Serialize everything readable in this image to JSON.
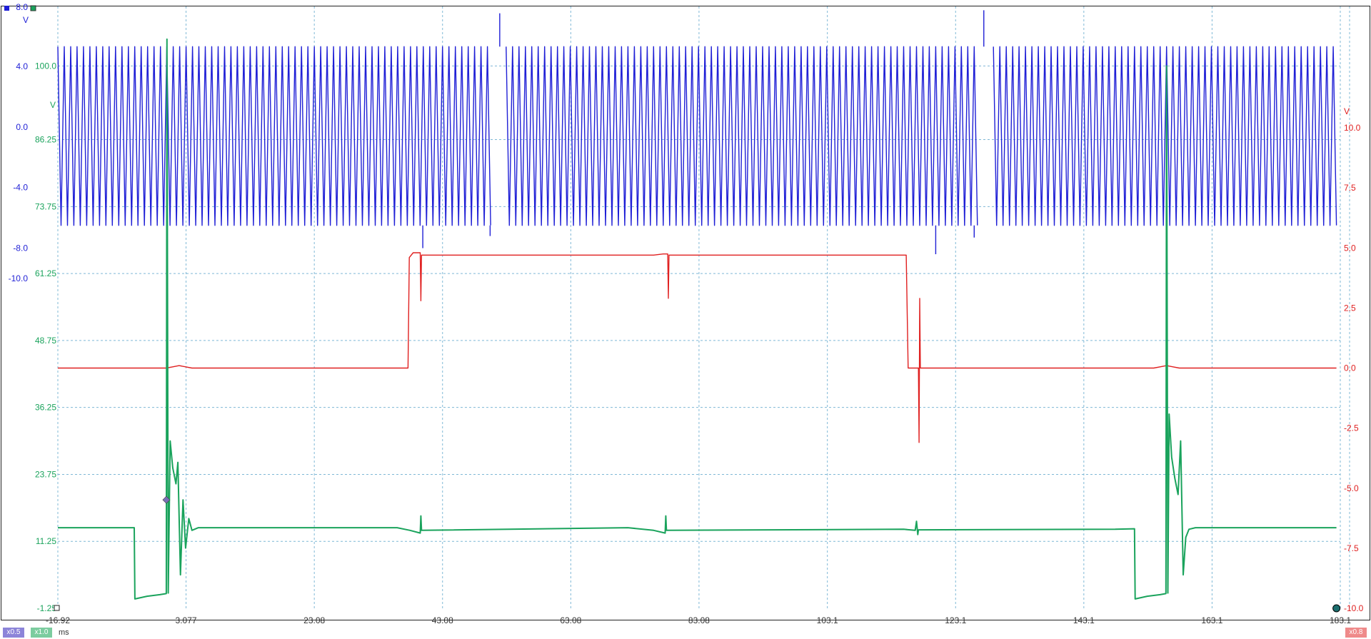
{
  "chart_data": {
    "type": "line",
    "title": "",
    "xlabel": "",
    "x_unit": "ms",
    "xlim": [
      -16.92,
      183.1
    ],
    "x_ticks": [
      -16.92,
      3.077,
      23.08,
      43.08,
      63.08,
      83.08,
      103.1,
      123.1,
      143.1,
      163.1,
      183.1
    ],
    "x_tick_labels": [
      "-16.92",
      "3.077",
      "23.08",
      "43.08",
      "63.08",
      "83.08",
      "103.1",
      "123.1",
      "143.1",
      "163.1",
      "183.1"
    ],
    "grid": true,
    "axes": [
      {
        "id": "blue",
        "unit": "V",
        "side": "left",
        "color": "#1f1fd6",
        "ylim": [
          -10.0,
          8.0
        ],
        "ticks": [
          8.0,
          4.0,
          0.0,
          -4.0,
          -8.0,
          -10.0
        ],
        "tick_labels": [
          "8.0",
          "4.0",
          "0.0",
          "-4.0",
          "-8.0",
          "-10.0"
        ]
      },
      {
        "id": "green",
        "unit": "V",
        "side": "left",
        "color": "#1aa35c",
        "ylim": [
          -1.25,
          111.25
        ],
        "ticks": [
          100.0,
          86.25,
          73.75,
          61.25,
          48.75,
          36.25,
          23.75,
          11.25,
          -1.25
        ],
        "tick_labels": [
          "100.0",
          "86.25",
          "73.75",
          "61.25",
          "48.75",
          "36.25",
          "23.75",
          "11.25",
          "-1.25"
        ]
      },
      {
        "id": "red",
        "unit": "V",
        "side": "right",
        "color": "#e02020",
        "ylim": [
          -10.0,
          10.0
        ],
        "ticks": [
          10.0,
          7.5,
          5.0,
          2.5,
          0.0,
          -2.5,
          -5.0,
          -7.5,
          -10.0
        ],
        "tick_labels": [
          "10.0",
          "7.5",
          "5.0",
          "2.5",
          "0.0",
          "-2.5",
          "-5.0",
          "-7.5",
          "-10.0"
        ]
      }
    ],
    "series": [
      {
        "id": "blue",
        "axis": "blue",
        "kind": "oscillation",
        "segments": [
          [
            -16.92,
            51.0
          ],
          [
            53.0,
            126.5
          ],
          [
            129.0,
            182.5
          ]
        ],
        "period_ms": 1.0,
        "amplitude_high": 5.3,
        "amplitude_low": -6.5,
        "glitches": [
          {
            "x": 52.0,
            "y": 7.5
          },
          {
            "x": 127.5,
            "y": 7.7
          },
          {
            "x": 50.5,
            "y": -7.2
          },
          {
            "x": 126.0,
            "y": -7.3
          },
          {
            "x": 120.0,
            "y": -8.4
          },
          {
            "x": 40.0,
            "y": -8.0
          }
        ]
      },
      {
        "id": "red",
        "axis": "red",
        "points": [
          [
            -16.92,
            0.0
          ],
          [
            0.0,
            0.0
          ],
          [
            1.0,
            0.05
          ],
          [
            2.0,
            0.1
          ],
          [
            3.0,
            0.05
          ],
          [
            4.0,
            0.0
          ],
          [
            37.7,
            0.0
          ],
          [
            37.9,
            4.6
          ],
          [
            38.5,
            4.8
          ],
          [
            39.6,
            4.8
          ],
          [
            39.7,
            2.8
          ],
          [
            39.8,
            4.7
          ],
          [
            76.0,
            4.7
          ],
          [
            77.5,
            4.75
          ],
          [
            78.2,
            4.75
          ],
          [
            78.3,
            2.9
          ],
          [
            78.4,
            4.7
          ],
          [
            115.4,
            4.7
          ],
          [
            115.7,
            0.0
          ],
          [
            117.3,
            0.0
          ],
          [
            117.4,
            -3.1
          ],
          [
            117.5,
            2.9
          ],
          [
            117.6,
            0.0
          ],
          [
            154.0,
            0.0
          ],
          [
            155.0,
            0.05
          ],
          [
            156.0,
            0.1
          ],
          [
            157.0,
            0.05
          ],
          [
            158.0,
            0.0
          ],
          [
            182.5,
            0.0
          ]
        ]
      },
      {
        "id": "green",
        "axis": "green",
        "points": [
          [
            -16.92,
            13.8
          ],
          [
            -5.0,
            13.8
          ],
          [
            -4.9,
            0.5
          ],
          [
            -3.0,
            1.0
          ],
          [
            -1.0,
            1.3
          ],
          [
            0.0,
            1.5
          ],
          [
            0.1,
            105.0
          ],
          [
            0.3,
            1.6
          ],
          [
            0.6,
            30.0
          ],
          [
            1.0,
            25.0
          ],
          [
            1.5,
            22.0
          ],
          [
            1.8,
            26.0
          ],
          [
            2.2,
            5.0
          ],
          [
            2.6,
            19.0
          ],
          [
            3.0,
            10.0
          ],
          [
            3.5,
            15.5
          ],
          [
            4.0,
            13.3
          ],
          [
            5.0,
            13.8
          ],
          [
            36.0,
            13.8
          ],
          [
            38.0,
            13.3
          ],
          [
            39.6,
            12.8
          ],
          [
            39.7,
            16.0
          ],
          [
            39.8,
            13.3
          ],
          [
            72.0,
            13.8
          ],
          [
            76.0,
            13.3
          ],
          [
            77.8,
            12.8
          ],
          [
            77.9,
            16.0
          ],
          [
            78.0,
            13.3
          ],
          [
            115.0,
            13.5
          ],
          [
            116.8,
            13.3
          ],
          [
            117.0,
            15.0
          ],
          [
            117.2,
            12.5
          ],
          [
            117.3,
            13.4
          ],
          [
            148.0,
            13.5
          ],
          [
            151.0,
            13.6
          ],
          [
            151.1,
            0.5
          ],
          [
            153.0,
            1.0
          ],
          [
            155.0,
            1.3
          ],
          [
            155.9,
            1.5
          ],
          [
            156.0,
            100.0
          ],
          [
            156.2,
            1.6
          ],
          [
            156.4,
            35.0
          ],
          [
            156.8,
            27.0
          ],
          [
            157.3,
            23.0
          ],
          [
            157.8,
            20.0
          ],
          [
            158.2,
            30.0
          ],
          [
            158.6,
            5.0
          ],
          [
            159.0,
            12.0
          ],
          [
            159.5,
            13.5
          ],
          [
            160.5,
            13.8
          ],
          [
            182.5,
            13.8
          ]
        ]
      }
    ],
    "cursors": [
      {
        "axis": "green",
        "x": 0.0,
        "y": 19.0,
        "shape": "diamond",
        "color": "#7a70b8"
      },
      {
        "axis": "red",
        "x": 182.5,
        "y": -10.0,
        "shape": "circle",
        "color": "#1c6e6e"
      }
    ]
  },
  "footer": {
    "x_unit": "ms",
    "badges": [
      {
        "label": "x0.5",
        "color": "#8c84d9"
      },
      {
        "label": "x1.0",
        "color": "#7ccc9f"
      },
      {
        "label": "x0.8",
        "color": "#ef8a8a"
      }
    ]
  }
}
